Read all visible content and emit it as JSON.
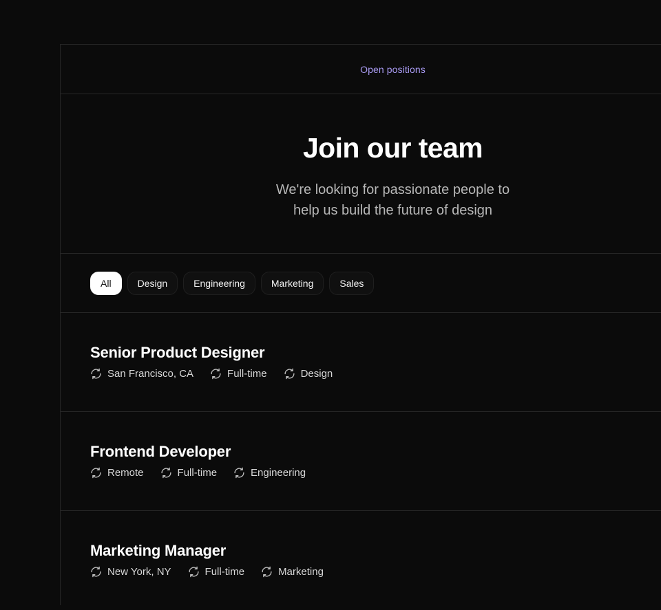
{
  "header": {
    "eyebrow": "Open positions"
  },
  "hero": {
    "title": "Join our team",
    "subtitle": "We're looking for passionate people to help us build the future of design"
  },
  "filters": [
    {
      "label": "All",
      "active": true
    },
    {
      "label": "Design",
      "active": false
    },
    {
      "label": "Engineering",
      "active": false
    },
    {
      "label": "Marketing",
      "active": false
    },
    {
      "label": "Sales",
      "active": false
    }
  ],
  "jobs": [
    {
      "title": "Senior Product Designer",
      "meta": [
        {
          "icon": "refresh-icon",
          "text": "San Francisco, CA"
        },
        {
          "icon": "refresh-icon",
          "text": "Full-time"
        },
        {
          "icon": "refresh-icon",
          "text": "Design"
        }
      ]
    },
    {
      "title": "Frontend Developer",
      "meta": [
        {
          "icon": "refresh-icon",
          "text": "Remote"
        },
        {
          "icon": "refresh-icon",
          "text": "Full-time"
        },
        {
          "icon": "refresh-icon",
          "text": "Engineering"
        }
      ]
    },
    {
      "title": "Marketing Manager",
      "meta": [
        {
          "icon": "refresh-icon",
          "text": "New York, NY"
        },
        {
          "icon": "refresh-icon",
          "text": "Full-time"
        },
        {
          "icon": "refresh-icon",
          "text": "Marketing"
        }
      ]
    }
  ],
  "colors": {
    "background": "#0b0b0b",
    "accent": "#a99bf2",
    "border": "#262626",
    "muted_text": "#b7b7b7"
  }
}
